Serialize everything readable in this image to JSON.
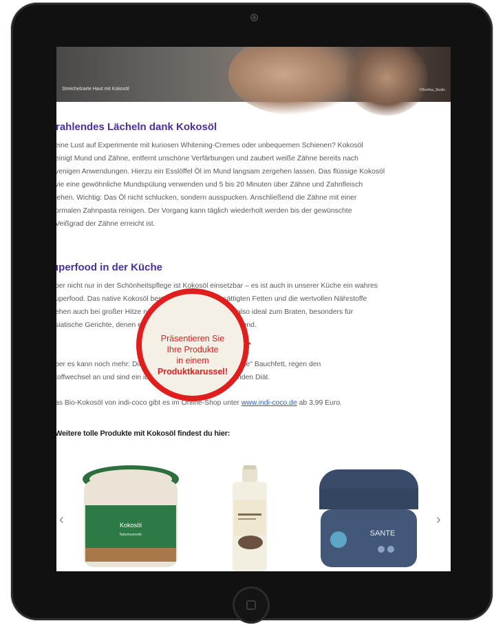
{
  "hero": {
    "caption": "Streichelzarte Haut mit Kokosöl",
    "credit": "©Bonfisa_Studio"
  },
  "sections": [
    {
      "heading": "trahlendes Lächeln dank Kokosöl",
      "lines": [
        "eine Lust auf Experimente mit kuriosen Whitening-Cremes oder unbequemen Schienen? Kokosöl",
        "einigt Mund und Zähne, entfernt unschöne Verfärbungen und zaubert weiße Zähne bereits nach",
        "venigen Anwendungen. Hierzu ein Esslöffel Öl im Mund langsam zergehen lassen. Das flüssige Kokosöl",
        "vie eine gewöhnliche Mundspülung verwenden und 5 bis 20 Minuten über Zähne und Zahnfleisch",
        "iehen. Wichtig: Das Öl nicht schlucken, sondern ausspucken. Anschließend die Zähne mit einer",
        "ormalen Zahnpasta reinigen. Der Vorgang kann täglich wiederholt werden bis der gewünschte",
        "Veißgrad der Zähne erreicht ist."
      ]
    },
    {
      "heading": "uperfood in der Küche",
      "lines": [
        "ber nicht nur in der Schönheitspflege ist Kokosöl einsetzbar – es ist auch in unserer Küche ein wahres",
        "uperfood. Das native Kokosöl besteht zu 90% aus gesättigten Fetten und die wertvollen Nährstoffe",
        "ehen auch bei großer Hitze nicht verloren. Es eignet sich also ideal zum Braten, besonders für",
        "siatische Gerichte, denen es eine exotische Note hervorragend."
      ],
      "lines2": [
        "ber es kann noch mehr: Die Fettsäuren bekämpfen das \"böse\" Bauchfett, regen den",
        "toffwechsel an und sind ein idealer Bestandteil einer gesunden Diät."
      ],
      "shop_prefix": "as Bio-Kokosöl von indi-coco gibt es im Online-Shop unter ",
      "shop_link": "www.indi-coco.de",
      "shop_suffix": " ab 3,99 Euro."
    }
  ],
  "more_products_label": "Weitere tolle Produkte mit Kokosöl findest du hier:",
  "carousel": {
    "prev_icon": "chevron-left-icon",
    "next_icon": "chevron-right-icon",
    "prev_glyph": "‹",
    "next_glyph": "›",
    "products": [
      {
        "brand": "Kokosöl",
        "note": "Naturkosmetik"
      },
      {
        "brand": "",
        "note": "lotion"
      },
      {
        "brand": "SANTE",
        "note": ""
      }
    ]
  },
  "promo": {
    "line1": "Präsentieren Sie",
    "line2": "Ihre Produkte",
    "line3": "in einem",
    "line4": "Produktkarussel!"
  },
  "colors": {
    "heading": "#4b2ea0",
    "promo_red": "#e11e1e",
    "link": "#2a5db0"
  }
}
